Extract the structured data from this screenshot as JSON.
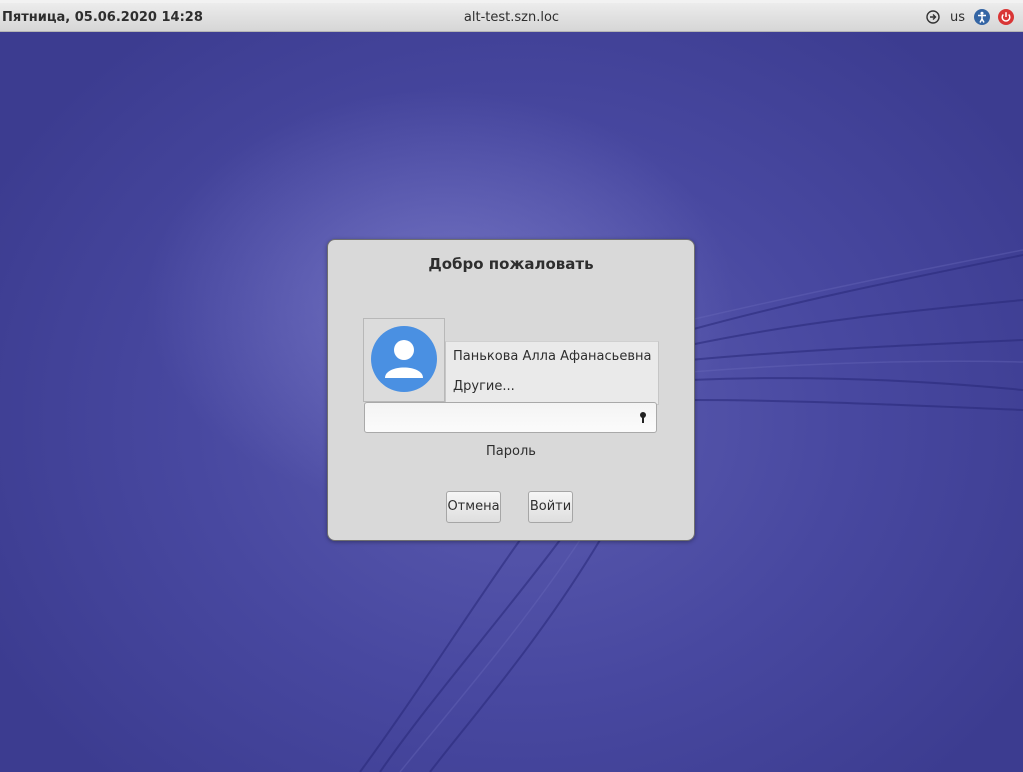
{
  "topbar": {
    "clock": "Пятница, 05.06.2020 14:28",
    "hostname": "alt-test.szn.loc",
    "keyboard_layout": "us",
    "icons": [
      "network-icon",
      "accessibility-icon",
      "power-icon"
    ]
  },
  "dialog": {
    "title": "Добро пожаловать",
    "users": [
      "Панькова Алла Афанасьевна",
      "Другие..."
    ],
    "password_value": "",
    "password_label": "Пароль",
    "cancel_label": "Отмена",
    "login_label": "Войти"
  },
  "colors": {
    "background": "#4a4a9c",
    "avatar": "#4a90e2",
    "power": "#d93535",
    "accessibility": "#3465a4"
  }
}
